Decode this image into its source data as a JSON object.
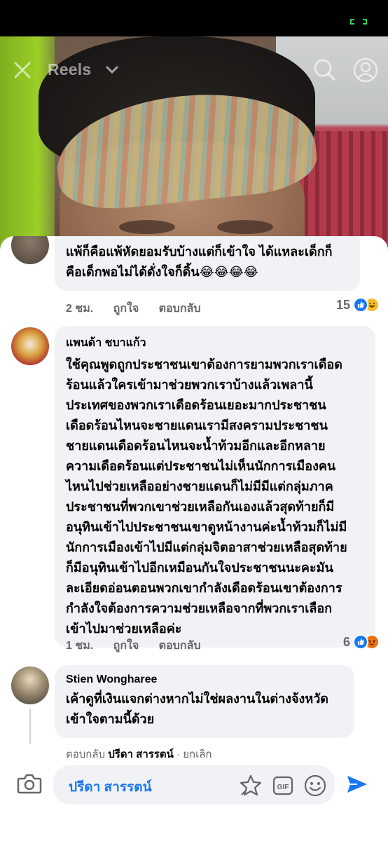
{
  "header": {
    "title": "Reels"
  },
  "colors": {
    "accent": "#1877f2",
    "bubble": "#f0f2f5",
    "meta": "#65676b",
    "battery": "#30d158"
  },
  "comments": [
    {
      "author": "",
      "lines": [
        "แพ้ก็คือแพ้หัดยอมรับบ้างแต่ก็เข้าใจ ได้แหละเด็กก็",
        "คือเด็กพอไม่ได้ดั่งใจก็ดิ้น😂😂😂😂"
      ],
      "time": "2 ชม.",
      "like_label": "ถูกใจ",
      "reply_label": "ตอบกลับ",
      "reaction_count": "15",
      "reactions": [
        "like-icon",
        "haha-icon"
      ]
    },
    {
      "author": "แพนด้า ชบาแก้ว",
      "lines": [
        "ใช้คุณพูดถูกประชาชนเขาต้องการยามพวกเราเดือด",
        "ร้อนแล้วใครเข้ามาช่วยพวกเราบ้างแล้วเพลานี้",
        "ประเทศของพวกเราเดือดร้อนเยอะมากประชาชน",
        "เดือดร้อนไหนจะชายแดนเรามีสงครามประชาชน",
        "ชายแดนเดือดร้อนไหนจะน้ำท้วมอีกและอีกหลาย",
        "ความเดือดร้อนแต่ประชาชนไม่เห็นนักการเมืองคน",
        "ไหนไปช่วยเหลืออย่างชายแดนก็ไม่มีมีแต่กลุ่มภาค",
        "ประชาชนที่พวกเขาช่วยเหลือกันเองแล้วสุดท้ายก็มี",
        "อนุทินเข้าไปประชาชนเขาดูหน้างานค่ะน้ำท้วมก็ไม่มี",
        "นักการเมืองเข้าไปมีแต่กลุ่มจิตอาสาช่วยเหลือสุดท้าย",
        "ก็มีอนุทินเข้าไปอีกเหมือนกันใจประชาชนนะคะมัน",
        "ละเอียดอ่อนตอนพวกเขากำลังเดือดร้อนเขาต้องการ",
        "กำลังใจต้องการความช่วยเหลือจากที่พวกเราเลือก",
        "เข้าไปมาช่วยเหลือค่ะ"
      ],
      "time": "1 ชม.",
      "like_label": "ถูกใจ",
      "reply_label": "ตอบกลับ",
      "reaction_count": "6",
      "reactions": [
        "like-icon",
        "angry-icon"
      ]
    },
    {
      "author": "Stien Wongharee",
      "lines": [
        "เค้าดูที่เงินแจกต่างหากไม่ใช่ผลงานในต่างจ้งหวัด",
        "เข้าใจตามนี้ด้วย"
      ]
    }
  ],
  "reply_bar": {
    "prefix": "ตอบกลับ",
    "name": "ปรีดา สารรตน์",
    "cancel": "· ยกเลิก"
  },
  "composer": {
    "input_value": "ปรีดา สารรตน์"
  }
}
